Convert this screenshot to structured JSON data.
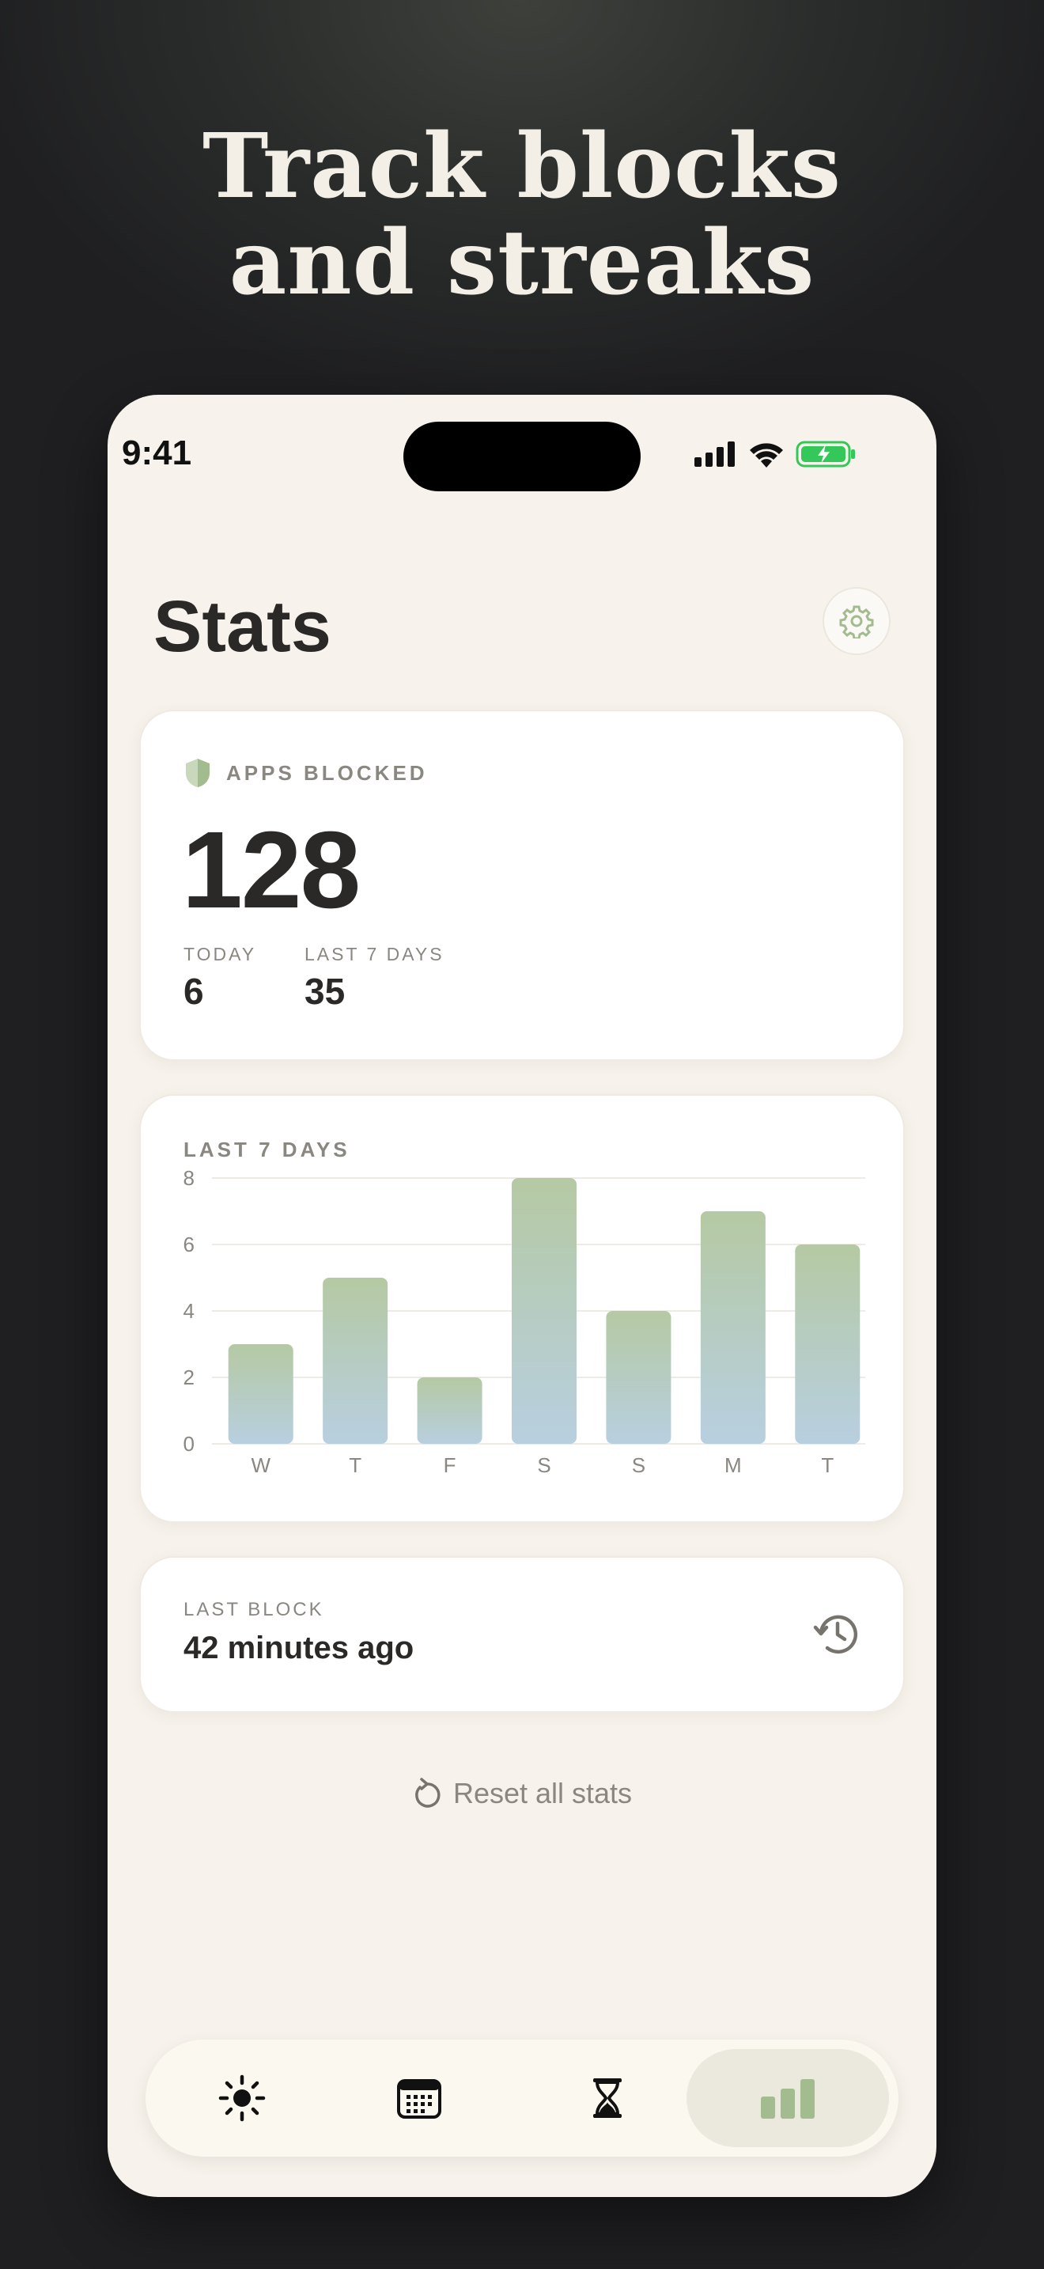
{
  "headline": {
    "line1": "Track blocks",
    "line2": "and streaks"
  },
  "status_bar": {
    "time": "9:41",
    "battery_color": "#34c759"
  },
  "header": {
    "title": "Stats"
  },
  "apps_blocked": {
    "label": "APPS BLOCKED",
    "total": "128",
    "today_label": "TODAY",
    "today_value": "6",
    "week_label": "LAST 7 DAYS",
    "week_value": "35"
  },
  "chart_card": {
    "label": "LAST 7 DAYS"
  },
  "chart_data": {
    "type": "bar",
    "categories": [
      "W",
      "T",
      "F",
      "S",
      "S",
      "M",
      "T"
    ],
    "values": [
      3,
      5,
      2,
      8,
      4,
      7,
      6
    ],
    "ylim": [
      0,
      8
    ],
    "yticks": [
      0,
      2,
      4,
      6,
      8
    ],
    "grid": true,
    "bar_gradient": [
      "#b5c9a3",
      "#b8cfe0"
    ]
  },
  "last_block": {
    "label": "LAST BLOCK",
    "value": "42 minutes ago"
  },
  "reset": {
    "label": "Reset all stats"
  },
  "tabs": [
    {
      "icon": "sun-icon",
      "active": false
    },
    {
      "icon": "calendar-icon",
      "active": false
    },
    {
      "icon": "hourglass-icon",
      "active": false
    },
    {
      "icon": "bar-chart-icon",
      "active": true
    }
  ],
  "colors": {
    "accent": "#a3bc8f",
    "background": "#f7f3ec",
    "text": "#2b2927"
  }
}
